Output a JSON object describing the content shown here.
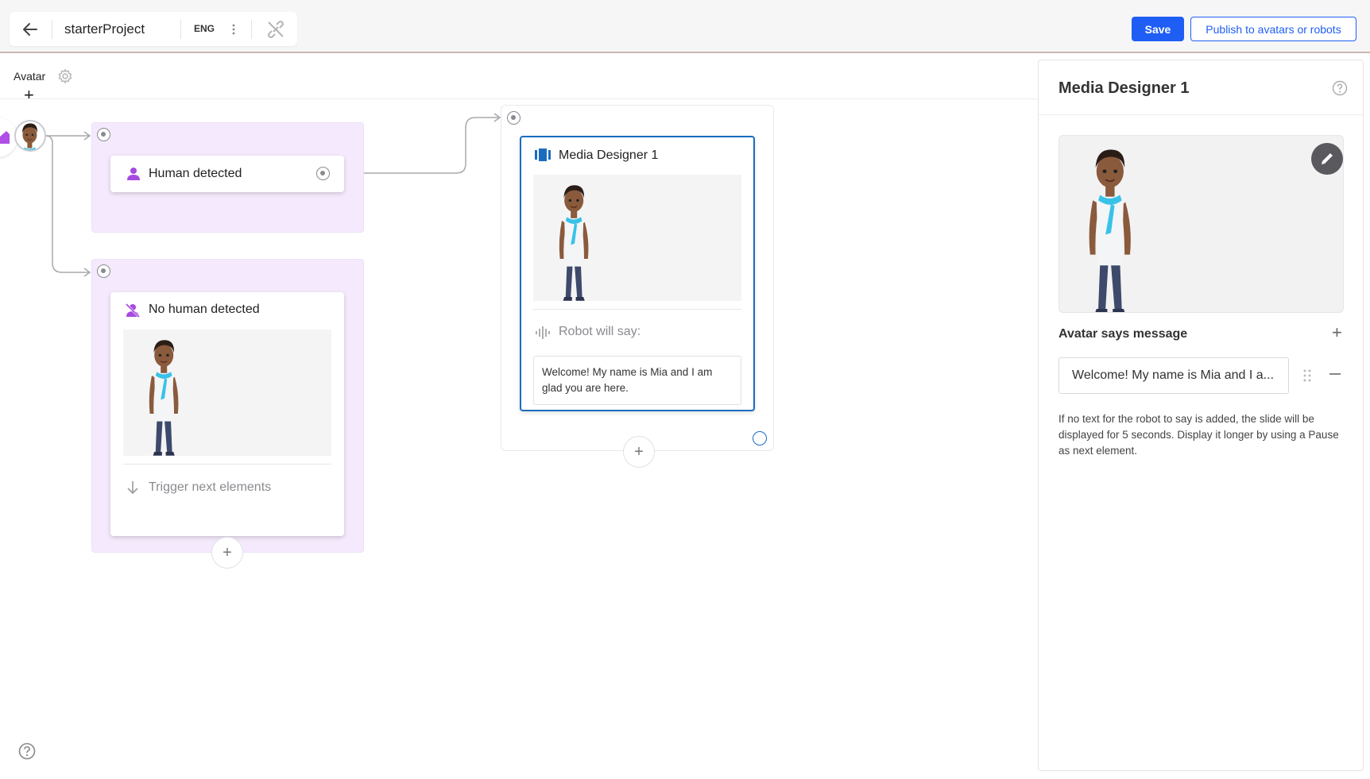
{
  "topbar": {
    "project_name": "starterProject",
    "language": "ENG",
    "save_label": "Save",
    "publish_label": "Publish to avatars or robots"
  },
  "canvas": {
    "avatar_label": "Avatar",
    "add_symbol": "+",
    "nodes": {
      "human_detected": {
        "title": "Human detected"
      },
      "no_human_detected": {
        "title": "No human detected",
        "trigger_label": "Trigger next elements"
      },
      "media_designer": {
        "title": "Media Designer 1",
        "robot_will_say": "Robot will say:",
        "message": "Welcome! My name is Mia and I am glad you are here."
      }
    },
    "add_circle_symbol": "+"
  },
  "panel": {
    "title": "Media Designer 1",
    "section_label": "Avatar says message",
    "add_symbol": "+",
    "message_value": "Welcome! My name is Mia and I a...",
    "note": "If no text for the robot to say is added, the slide will be displayed for 5 seconds. Display it longer by using a Pause as next element."
  },
  "colors": {
    "accent": "#1f5ef5",
    "group_purple": "#f5eafd",
    "node_icon_purple": "#a64ae0",
    "selected_border": "#1a6cc0"
  },
  "icons": [
    "back-arrow-icon",
    "kebab-icon",
    "link-off-icon",
    "gear-icon",
    "home-icon",
    "person-icon",
    "person-off-icon",
    "media-icon",
    "waveform-icon",
    "arrow-down-icon",
    "help-icon",
    "edit-icon",
    "drag-handle-icon"
  ]
}
